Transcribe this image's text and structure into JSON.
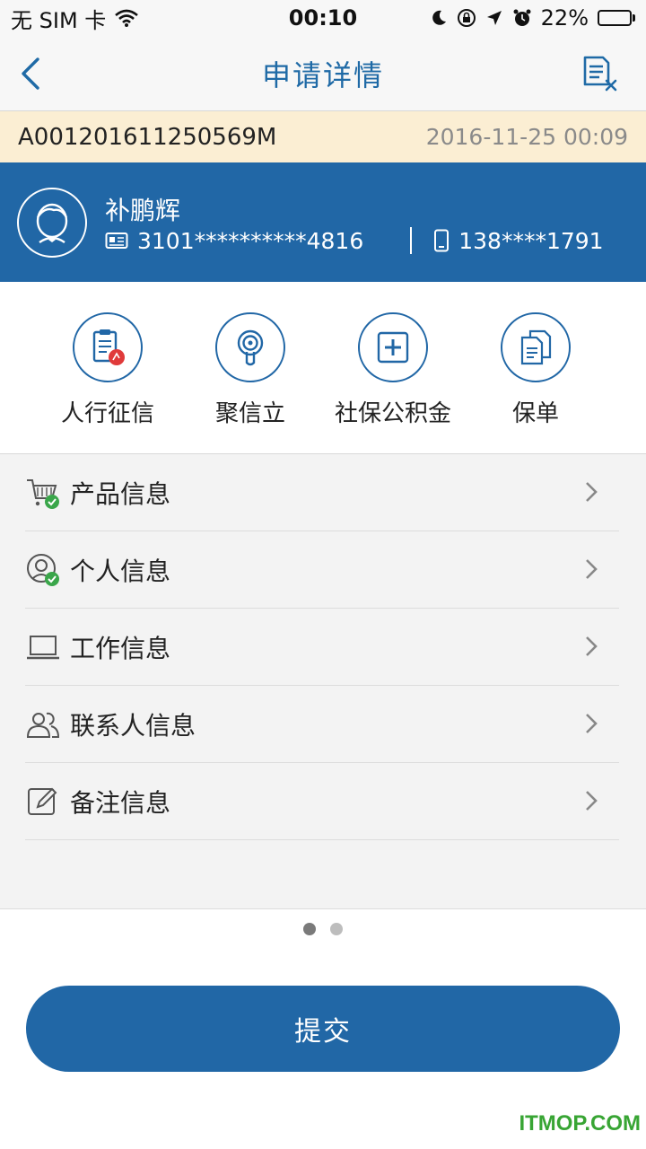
{
  "status_bar": {
    "carrier": "无 SIM 卡",
    "time": "00:10",
    "battery": "22%",
    "battery_level": 0.22
  },
  "nav": {
    "title": "申请详情",
    "back_icon": "chevron-left-icon",
    "action_icon": "document-cancel-icon"
  },
  "order": {
    "id": "A001201611250569M",
    "time": "2016-11-25 00:09"
  },
  "user": {
    "name": "补鹏辉",
    "id_number": "3101**********4816",
    "phone": "138****1791"
  },
  "quick_links": [
    {
      "label": "人行征信",
      "icon": "clipboard-icon"
    },
    {
      "label": "聚信立",
      "icon": "signal-icon"
    },
    {
      "label": "社保公积金",
      "icon": "medical-cross-icon"
    },
    {
      "label": "保单",
      "icon": "documents-icon"
    }
  ],
  "menu": [
    {
      "label": "产品信息",
      "icon": "cart-icon",
      "completed": true
    },
    {
      "label": "个人信息",
      "icon": "person-icon",
      "completed": true
    },
    {
      "label": "工作信息",
      "icon": "laptop-icon",
      "completed": false
    },
    {
      "label": "联系人信息",
      "icon": "contacts-icon",
      "completed": false
    },
    {
      "label": "备注信息",
      "icon": "edit-note-icon",
      "completed": false
    }
  ],
  "pager": {
    "total": 2,
    "current": 1
  },
  "submit_label": "提交",
  "watermark": "ITMOP.COM",
  "colors": {
    "primary": "#2167a6",
    "order_strip": "#fbeed3",
    "check": "#3aa64a",
    "badge": "#e03a3a"
  }
}
